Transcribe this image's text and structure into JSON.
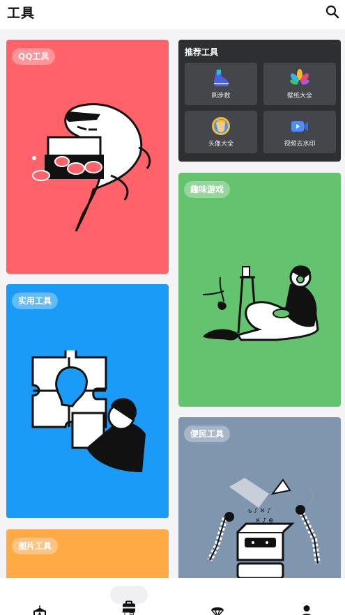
{
  "header": {
    "title": "工具",
    "search_icon": "search-icon"
  },
  "cards": {
    "qq": {
      "label": "QQ工具",
      "color": "#ff6369"
    },
    "practical": {
      "label": "实用工具",
      "color": "#1b9bf8"
    },
    "image": {
      "label": "图片工具",
      "color": "#ffaa45"
    },
    "fun": {
      "label": "趣味游戏",
      "color": "#63c36f"
    },
    "convenience": {
      "label": "便民工具",
      "color": "#7f96ae"
    }
  },
  "recommended": {
    "title": "推荐工具",
    "items": [
      {
        "label": "刷步数",
        "icon": "sneaker-icon"
      },
      {
        "label": "壁纸大全",
        "icon": "flower-icon"
      },
      {
        "label": "头像大全",
        "icon": "avatar-icon"
      },
      {
        "label": "视频去水印",
        "icon": "video-camera-icon"
      }
    ]
  },
  "tabbar": {
    "items": [
      {
        "icon": "circus-tent-icon"
      },
      {
        "icon": "toolbox-icon",
        "label": "工具",
        "active": true
      },
      {
        "icon": "parachute-icon"
      },
      {
        "icon": "person-icon"
      }
    ]
  }
}
